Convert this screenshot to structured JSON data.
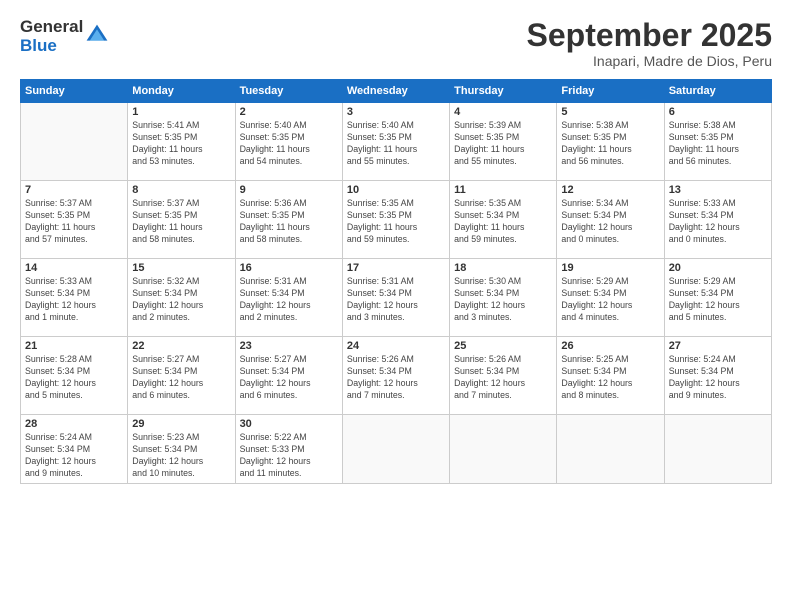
{
  "logo": {
    "general": "General",
    "blue": "Blue"
  },
  "title": "September 2025",
  "subtitle": "Inapari, Madre de Dios, Peru",
  "weekdays": [
    "Sunday",
    "Monday",
    "Tuesday",
    "Wednesday",
    "Thursday",
    "Friday",
    "Saturday"
  ],
  "weeks": [
    [
      {
        "day": "",
        "info": ""
      },
      {
        "day": "1",
        "info": "Sunrise: 5:41 AM\nSunset: 5:35 PM\nDaylight: 11 hours\nand 53 minutes."
      },
      {
        "day": "2",
        "info": "Sunrise: 5:40 AM\nSunset: 5:35 PM\nDaylight: 11 hours\nand 54 minutes."
      },
      {
        "day": "3",
        "info": "Sunrise: 5:40 AM\nSunset: 5:35 PM\nDaylight: 11 hours\nand 55 minutes."
      },
      {
        "day": "4",
        "info": "Sunrise: 5:39 AM\nSunset: 5:35 PM\nDaylight: 11 hours\nand 55 minutes."
      },
      {
        "day": "5",
        "info": "Sunrise: 5:38 AM\nSunset: 5:35 PM\nDaylight: 11 hours\nand 56 minutes."
      },
      {
        "day": "6",
        "info": "Sunrise: 5:38 AM\nSunset: 5:35 PM\nDaylight: 11 hours\nand 56 minutes."
      }
    ],
    [
      {
        "day": "7",
        "info": "Sunrise: 5:37 AM\nSunset: 5:35 PM\nDaylight: 11 hours\nand 57 minutes."
      },
      {
        "day": "8",
        "info": "Sunrise: 5:37 AM\nSunset: 5:35 PM\nDaylight: 11 hours\nand 58 minutes."
      },
      {
        "day": "9",
        "info": "Sunrise: 5:36 AM\nSunset: 5:35 PM\nDaylight: 11 hours\nand 58 minutes."
      },
      {
        "day": "10",
        "info": "Sunrise: 5:35 AM\nSunset: 5:35 PM\nDaylight: 11 hours\nand 59 minutes."
      },
      {
        "day": "11",
        "info": "Sunrise: 5:35 AM\nSunset: 5:34 PM\nDaylight: 11 hours\nand 59 minutes."
      },
      {
        "day": "12",
        "info": "Sunrise: 5:34 AM\nSunset: 5:34 PM\nDaylight: 12 hours\nand 0 minutes."
      },
      {
        "day": "13",
        "info": "Sunrise: 5:33 AM\nSunset: 5:34 PM\nDaylight: 12 hours\nand 0 minutes."
      }
    ],
    [
      {
        "day": "14",
        "info": "Sunrise: 5:33 AM\nSunset: 5:34 PM\nDaylight: 12 hours\nand 1 minute."
      },
      {
        "day": "15",
        "info": "Sunrise: 5:32 AM\nSunset: 5:34 PM\nDaylight: 12 hours\nand 2 minutes."
      },
      {
        "day": "16",
        "info": "Sunrise: 5:31 AM\nSunset: 5:34 PM\nDaylight: 12 hours\nand 2 minutes."
      },
      {
        "day": "17",
        "info": "Sunrise: 5:31 AM\nSunset: 5:34 PM\nDaylight: 12 hours\nand 3 minutes."
      },
      {
        "day": "18",
        "info": "Sunrise: 5:30 AM\nSunset: 5:34 PM\nDaylight: 12 hours\nand 3 minutes."
      },
      {
        "day": "19",
        "info": "Sunrise: 5:29 AM\nSunset: 5:34 PM\nDaylight: 12 hours\nand 4 minutes."
      },
      {
        "day": "20",
        "info": "Sunrise: 5:29 AM\nSunset: 5:34 PM\nDaylight: 12 hours\nand 5 minutes."
      }
    ],
    [
      {
        "day": "21",
        "info": "Sunrise: 5:28 AM\nSunset: 5:34 PM\nDaylight: 12 hours\nand 5 minutes."
      },
      {
        "day": "22",
        "info": "Sunrise: 5:27 AM\nSunset: 5:34 PM\nDaylight: 12 hours\nand 6 minutes."
      },
      {
        "day": "23",
        "info": "Sunrise: 5:27 AM\nSunset: 5:34 PM\nDaylight: 12 hours\nand 6 minutes."
      },
      {
        "day": "24",
        "info": "Sunrise: 5:26 AM\nSunset: 5:34 PM\nDaylight: 12 hours\nand 7 minutes."
      },
      {
        "day": "25",
        "info": "Sunrise: 5:26 AM\nSunset: 5:34 PM\nDaylight: 12 hours\nand 7 minutes."
      },
      {
        "day": "26",
        "info": "Sunrise: 5:25 AM\nSunset: 5:34 PM\nDaylight: 12 hours\nand 8 minutes."
      },
      {
        "day": "27",
        "info": "Sunrise: 5:24 AM\nSunset: 5:34 PM\nDaylight: 12 hours\nand 9 minutes."
      }
    ],
    [
      {
        "day": "28",
        "info": "Sunrise: 5:24 AM\nSunset: 5:34 PM\nDaylight: 12 hours\nand 9 minutes."
      },
      {
        "day": "29",
        "info": "Sunrise: 5:23 AM\nSunset: 5:34 PM\nDaylight: 12 hours\nand 10 minutes."
      },
      {
        "day": "30",
        "info": "Sunrise: 5:22 AM\nSunset: 5:33 PM\nDaylight: 12 hours\nand 11 minutes."
      },
      {
        "day": "",
        "info": ""
      },
      {
        "day": "",
        "info": ""
      },
      {
        "day": "",
        "info": ""
      },
      {
        "day": "",
        "info": ""
      }
    ]
  ]
}
